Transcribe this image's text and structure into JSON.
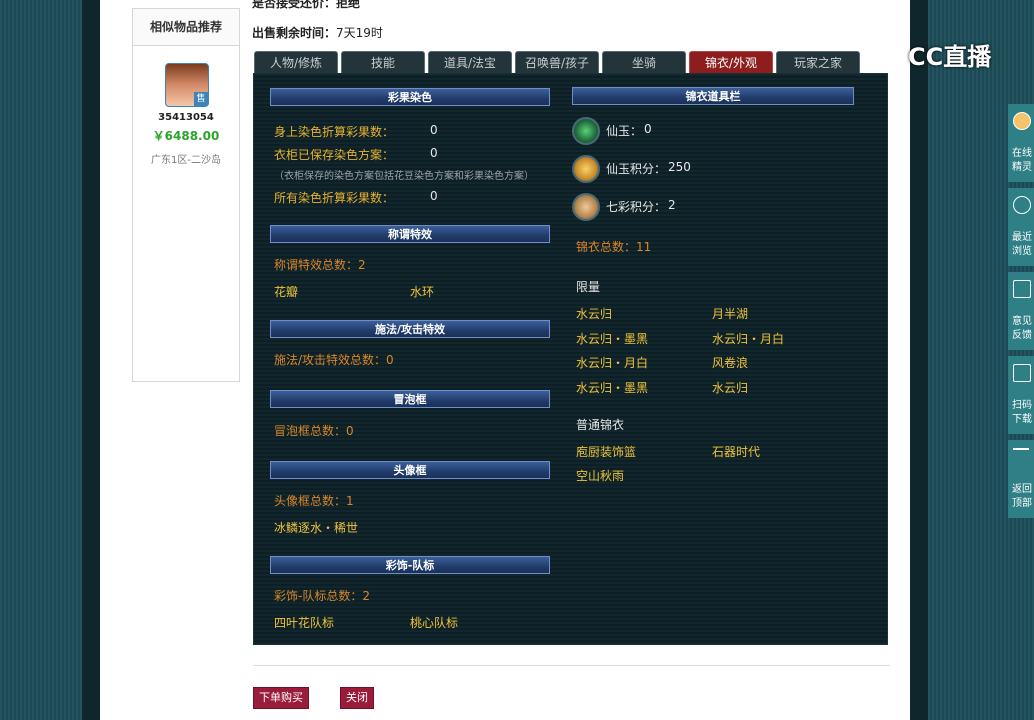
{
  "top": {
    "partial_line": "是否接受还价：拒绝",
    "time_label": "出售剩余时间：",
    "time_value": "7天19时"
  },
  "sidebar": {
    "title": "相似物品推荐",
    "badge": "售",
    "item_id": "35413054",
    "price": "￥6488.00",
    "server": "广东1区-二沙岛"
  },
  "tabs": [
    {
      "label": "人物/修炼"
    },
    {
      "label": "技能"
    },
    {
      "label": "道具/法宝"
    },
    {
      "label": "召唤兽/孩子"
    },
    {
      "label": "坐骑"
    },
    {
      "label": "锦衣/外观",
      "active": true
    },
    {
      "label": "玩家之家"
    }
  ],
  "left": {
    "dye": {
      "header": "彩果染色",
      "row1_label": "身上染色折算彩果数：",
      "row1_value": "0",
      "row2_label": "衣柜已保存染色方案：",
      "row2_value": "0",
      "note": "（衣柜保存的染色方案包括花豆染色方案和彩果染色方案）",
      "row3_label": "所有染色折算彩果数：",
      "row3_value": "0"
    },
    "title_effect": {
      "header": "称谓特效",
      "count": "称谓特效总数：2",
      "items": [
        "花瓣",
        "水环"
      ]
    },
    "spell_effect": {
      "header": "施法/攻击特效",
      "count": "施法/攻击特效总数：0"
    },
    "bubble": {
      "header": "冒泡框",
      "count": "冒泡框总数：0"
    },
    "avatar_frame": {
      "header": "头像框",
      "count": "头像框总数：1",
      "items": [
        "冰鳞逐水・稀世"
      ]
    },
    "team_badge": {
      "header": "彩饰-队标",
      "count": "彩饰-队标总数：2",
      "items": [
        "四叶花队标",
        "桃心队标"
      ]
    }
  },
  "right": {
    "header": "锦衣道具栏",
    "currency": [
      {
        "label": "仙玉：",
        "value": "0",
        "icon": "jade-icon",
        "color": "#2e8c4a"
      },
      {
        "label": "仙玉积分：",
        "value": "250",
        "icon": "points-icon",
        "color": "#c98a2a"
      },
      {
        "label": "七彩积分：",
        "value": "2",
        "icon": "rainbow-icon",
        "color": "#b5874f"
      }
    ],
    "total": "锦衣总数：11",
    "limited_title": "限量",
    "limited": [
      "水云归",
      "月半湖",
      "水云归・墨黑",
      "水云归・月白",
      "水云归・月白",
      "风卷浪",
      "水云归・墨黑",
      "水云归"
    ],
    "normal_title": "普通锦衣",
    "normal": [
      "庖厨装饰篮",
      "石器时代",
      "空山秋雨"
    ]
  },
  "buttons": {
    "order": "下单购买",
    "close": "关闭"
  },
  "watermark": "CC直播",
  "side_tools": [
    {
      "line1": "在线",
      "line2": "精灵"
    },
    {
      "line1": "最近",
      "line2": "浏览"
    },
    {
      "line1": "意见",
      "line2": "反馈"
    },
    {
      "line1": "扫码",
      "line2": "下载"
    },
    {
      "line1": "返回",
      "line2": "顶部"
    }
  ],
  "colors": {
    "panel_bg": "#0f2329",
    "active_tab": "#8e1d1d",
    "orange_text": "#d9862b",
    "gold_text": "#e8b230",
    "price_green": "#2aa52a",
    "button": "#9b1b3a"
  }
}
